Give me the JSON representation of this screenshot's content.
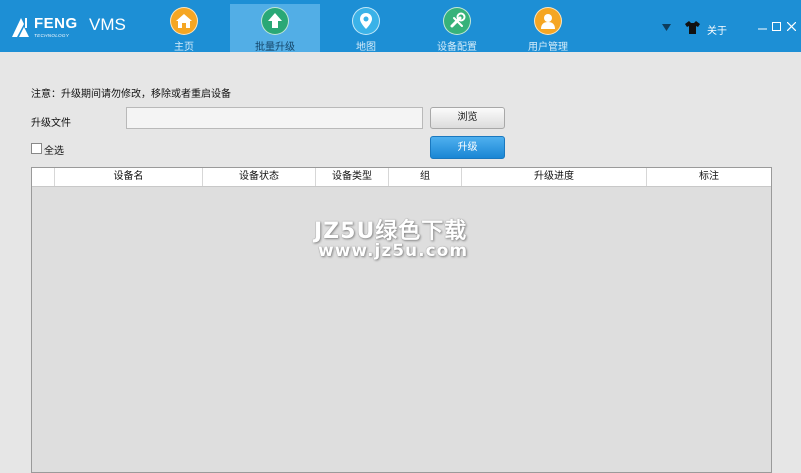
{
  "app": {
    "logo_text": "FENG",
    "logo_subtext": "TECHNOLOGY",
    "name": "VMS"
  },
  "nav": {
    "tabs": [
      {
        "label": "主页",
        "icon": "home-icon",
        "active": false
      },
      {
        "label": "批量升级",
        "icon": "upload-arrow-icon",
        "active": true
      },
      {
        "label": "地图",
        "icon": "map-pin-icon",
        "active": false
      },
      {
        "label": "设备配置",
        "icon": "wrench-icon",
        "active": false
      },
      {
        "label": "用户管理",
        "icon": "user-icon",
        "active": false
      }
    ]
  },
  "header_tools": {
    "dropdown_icon": "triangle-down-icon",
    "skin_icon": "shirt-icon",
    "about_label": "关于",
    "minimize_icon": "minimize-icon",
    "maximize_icon": "maximize-icon",
    "close_icon": "close-icon"
  },
  "upgrade": {
    "notice": "注意：升级期间请勿修改，移除或者重启设备",
    "file_label": "升级文件",
    "file_value": "",
    "browse_label": "浏览",
    "select_all_label": "全选",
    "select_all_checked": false,
    "upgrade_label": "升级"
  },
  "table": {
    "columns": [
      "",
      "设备名",
      "设备状态",
      "设备类型",
      "组",
      "升级进度",
      "标注"
    ],
    "rows": []
  },
  "watermark": {
    "line1": "JZ5U绿色下载",
    "line2": "www.jz5u.com"
  },
  "colors": {
    "header_bg": "#1d8fd5",
    "active_tab_bg": "#52aee6",
    "home_icon": "#f5a623",
    "upload_icon": "#2aa876",
    "map_icon": "#3ab2e8",
    "wrench_icon": "#36b27a",
    "user_icon": "#f5a623",
    "upgrade_button": "#1a86d4"
  }
}
